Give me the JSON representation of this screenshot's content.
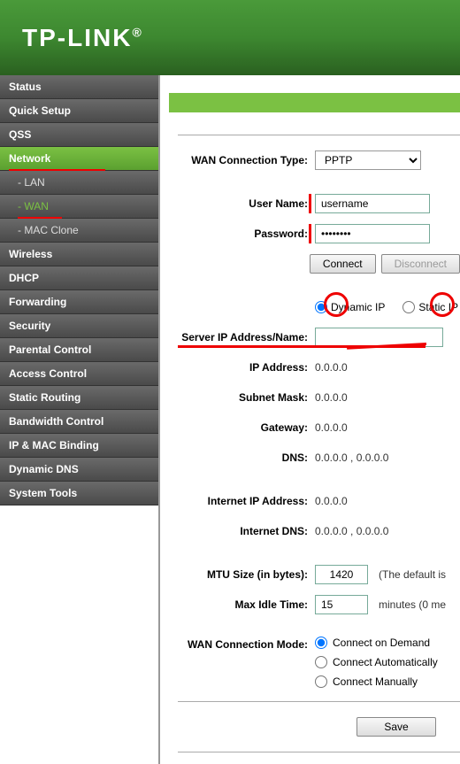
{
  "logo": "TP-LINK",
  "sidebar": {
    "items": [
      {
        "label": "Status"
      },
      {
        "label": "Quick Setup"
      },
      {
        "label": "QSS"
      },
      {
        "label": "Network",
        "active": true,
        "sub": [
          {
            "label": "- LAN"
          },
          {
            "label": "- WAN",
            "active": true
          },
          {
            "label": "- MAC Clone"
          }
        ]
      },
      {
        "label": "Wireless"
      },
      {
        "label": "DHCP"
      },
      {
        "label": "Forwarding"
      },
      {
        "label": "Security"
      },
      {
        "label": "Parental Control"
      },
      {
        "label": "Access Control"
      },
      {
        "label": "Static Routing"
      },
      {
        "label": "Bandwidth Control"
      },
      {
        "label": "IP & MAC Binding"
      },
      {
        "label": "Dynamic DNS"
      },
      {
        "label": "System Tools"
      }
    ]
  },
  "form": {
    "wan_conn_type_label": "WAN Connection Type:",
    "wan_conn_type_value": "PPTP",
    "username_label": "User Name:",
    "username_value": "username",
    "password_label": "Password:",
    "password_value": "••••••••",
    "connect_btn": "Connect",
    "disconnect_btn": "Disconnect",
    "dynamic_ip_label": "Dynamic IP",
    "static_ip_label": "Static IP",
    "server_ip_label": "Server IP Address/Name:",
    "server_ip_value": "",
    "ip_address_label": "IP Address:",
    "ip_address_value": "0.0.0.0",
    "subnet_label": "Subnet Mask:",
    "subnet_value": "0.0.0.0",
    "gateway_label": "Gateway:",
    "gateway_value": "0.0.0.0",
    "dns_label": "DNS:",
    "dns_value": "0.0.0.0 , 0.0.0.0",
    "internet_ip_label": "Internet IP Address:",
    "internet_ip_value": "0.0.0.0",
    "internet_dns_label": "Internet DNS:",
    "internet_dns_value": "0.0.0.0 , 0.0.0.0",
    "mtu_label": "MTU Size (in bytes):",
    "mtu_value": "1420",
    "mtu_hint": "(The default is",
    "idle_label": "Max Idle Time:",
    "idle_value": "15",
    "idle_hint": "minutes (0 me",
    "conn_mode_label": "WAN Connection Mode:",
    "conn_mode_1": "Connect on Demand",
    "conn_mode_2": "Connect Automatically",
    "conn_mode_3": "Connect Manually",
    "save_btn": "Save"
  }
}
